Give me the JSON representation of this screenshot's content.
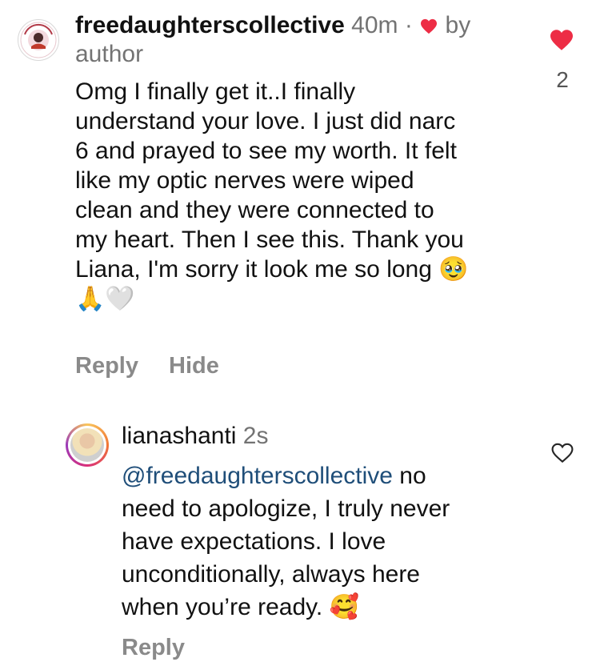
{
  "comment1": {
    "username": "freedaughterscollective",
    "time": "40m",
    "separator": "·",
    "by_label": "by",
    "author_label": "author",
    "lines": [
      "Omg I finally get it..I finally",
      "understand your love. I just did narc",
      "6 and prayed to see my worth. It felt",
      "like my optic nerves were wiped",
      "clean and they were connected to",
      "my heart.  Then I see this. Thank you",
      "Liana, I'm sorry it look me so long"
    ],
    "last_line_emoji": "🥹",
    "extra_emoji": "🙏🤍",
    "reply_label": "Reply",
    "hide_label": "Hide",
    "like_count": "2"
  },
  "comment2": {
    "username": "lianashanti",
    "time": "2s",
    "mention": "@freedaughterscollective",
    "first_line_rest": " no",
    "lines": [
      "need to apologize, I truly never",
      "have expectations. I love",
      "unconditionally, always here",
      "when you’re ready. "
    ],
    "end_emoji": "🥰",
    "reply_label": "Reply"
  },
  "colors": {
    "like_red": "#ed2d45",
    "mention_blue": "#1f4e79",
    "meta_gray": "#737373"
  }
}
